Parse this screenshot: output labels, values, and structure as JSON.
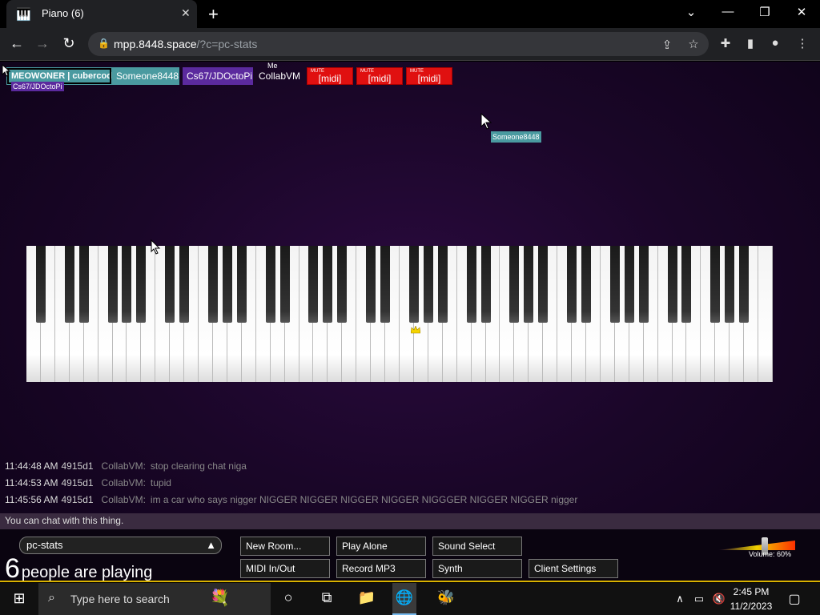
{
  "browser": {
    "tab_title": "Piano (6)",
    "favicon": "piano-icon",
    "url_host": "mpp.8448.space",
    "url_path": "/?c=pc-stats"
  },
  "nametags": [
    {
      "label": "MEOWONER | cubercoder_",
      "color": "#4a9aa0",
      "dark_outline": true
    },
    {
      "label": "Someone8448",
      "color": "#4a9aa0"
    },
    {
      "label": "Cs67/JDOctoPi",
      "color": "#5b2a9e"
    },
    {
      "label": "CollabVM",
      "color": "#1a0628",
      "me": "Me"
    }
  ],
  "mute_tags": [
    {
      "small": "MUTE",
      "label": "[midi]"
    },
    {
      "small": "MUTE",
      "label": "[midi]"
    },
    {
      "small": "MUTE",
      "label": "[midi]"
    }
  ],
  "cursor_labels": {
    "sub_tag": "Cs67/JDOctoPi",
    "floating": "Someone8448"
  },
  "chat": [
    {
      "time": "11:44:48 AM",
      "id": "4915d1",
      "nick": "CollabVM:",
      "msg": "stop clearing chat niga"
    },
    {
      "time": "11:44:53 AM",
      "id": "4915d1",
      "nick": "CollabVM:",
      "msg": "tupid"
    },
    {
      "time": "11:45:56 AM",
      "id": "4915d1",
      "nick": "CollabVM:",
      "msg": "im a car who says nigger NIGGER NIGGER NIGGER NIGGER NIGGGER NIGGER NIGGER nigger"
    }
  ],
  "chat_placeholder": "You can chat with this thing.",
  "room": {
    "name": "pc-stats",
    "people_count": "6",
    "people_text": "people are playing"
  },
  "buttons": {
    "new_room": "New Room...",
    "play_alone": "Play Alone",
    "sound_select": "Sound Select",
    "midi": "MIDI In/Out",
    "record": "Record MP3",
    "synth": "Synth",
    "client_settings": "Client Settings"
  },
  "volume": {
    "label": "Volume: 60%",
    "level": 0.6
  },
  "taskbar": {
    "search_placeholder": "Type here to search",
    "time": "2:45 PM",
    "date": "11/2/2023"
  },
  "colors": {
    "mute_red": "#e01010",
    "taskbar_accent": "#d9b200",
    "crown": "#f5d400"
  }
}
